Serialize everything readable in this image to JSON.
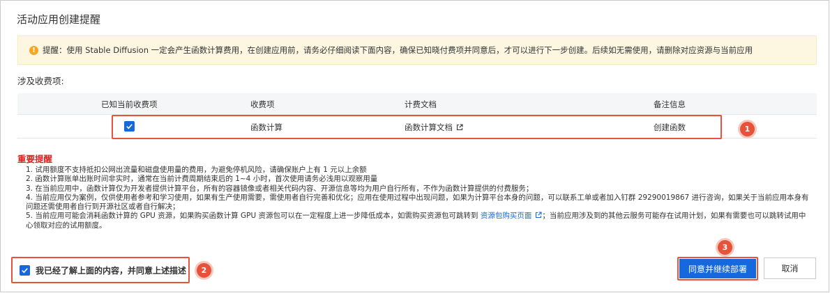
{
  "dialog": {
    "title": "活动应用创建提醒"
  },
  "notice": {
    "icon": "warning-icon",
    "text": "提醒：使用 Stable Diffusion 一定会产生函数计算费用，在创建应用前，请务必仔细阅读下面内容，确保已知晓付费项并同意后，才可以进行下一步创建。后续如无需使用，请删除对应资源与当前应用"
  },
  "charges": {
    "section_label": "涉及收费项:",
    "headers": [
      "已知当前收费项",
      "收费项",
      "计费文档",
      "备注信息"
    ],
    "rows": [
      {
        "acknowledged": true,
        "item": "函数计算",
        "doc_link": "函数计算文档",
        "note": "创建函数"
      }
    ]
  },
  "important": {
    "title": "重要提醒",
    "items": [
      "1. 试用额度不支持抵扣公网出流量和磁盘使用量的费用，为避免停机风险，请确保账户上有 1 元以上余额",
      "2. 函数计算账单出账时间非实时，通常在当前计费周期结束后的 1~4 小时，首次使用请务必浅用以观察用量",
      "3. 在当前应用中，函数计算仅为开发者提供计算平台，所有的容器镜像或者相关代码内容、开源信息等均为用户自行所有，不作为函数计算提供的付费服务；",
      "4. 当前应用仅为案例，仅供使用者参考和学习使用，如果有生产使用需要，需使用者自行完善和优化；应用在使用过程中出现问题，如果为计算平台本身的问题，可以联系工单或者加入钉群 29290019867 进行咨询，如果关于当前应用本身有问题还需使用者自行到开源社区或者自行解决；"
    ],
    "item5_before": "5. 当前应用可能会消耗函数计算的 GPU 资源，如果购买函数计算 GPU 资源包可以在一定程度上进一步降低成本，如需购买资源包可跳转到 ",
    "item5_link": "资源包购买页面",
    "item5_after": "；当前应用涉及到的其他云服务可能存在试用计划，如果有需要也可以跳转试用中心领取对应的试用额度。"
  },
  "footer": {
    "agree_checked": true,
    "agree_label": "我已经了解上面的内容，并同意上述描述",
    "confirm_label": "同意并继续部署",
    "cancel_label": "取消"
  },
  "annotations": {
    "badge_1": "1",
    "badge_2": "2",
    "badge_3": "3"
  },
  "colors": {
    "primary": "#1668dc",
    "highlight": "#e8513a",
    "notice_bg": "#fdf7e2",
    "important": "#e02020"
  }
}
